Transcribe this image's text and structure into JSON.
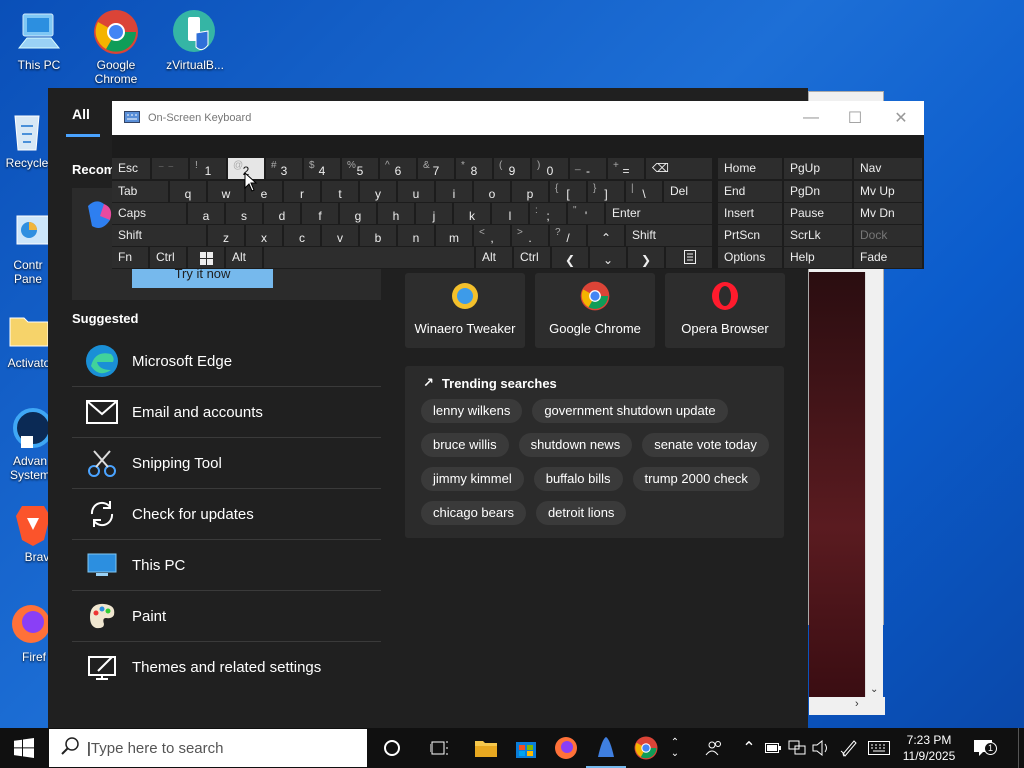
{
  "desktop": {
    "icons": [
      {
        "label": "This PC"
      },
      {
        "label": "Google Chrome"
      },
      {
        "label": "zVirtualB..."
      },
      {
        "label": "Recycle"
      },
      {
        "label": "Contr Pane"
      },
      {
        "label": "Activato"
      },
      {
        "label": "Advan System"
      },
      {
        "label": "Brav"
      },
      {
        "label": "Firef"
      }
    ]
  },
  "start_menu": {
    "tab": "All",
    "recommended_label": "Recom",
    "try_button": "Try it now",
    "suggested_label": "Suggested",
    "suggested": [
      {
        "label": "Microsoft Edge",
        "icon": "edge-icon"
      },
      {
        "label": "Email and accounts",
        "icon": "mail-icon"
      },
      {
        "label": "Snipping Tool",
        "icon": "snipping-tool-icon"
      },
      {
        "label": "Check for updates",
        "icon": "sync-icon"
      },
      {
        "label": "This PC",
        "icon": "monitor-icon"
      },
      {
        "label": "Paint",
        "icon": "palette-icon"
      },
      {
        "label": "Themes and related settings",
        "icon": "pen-screen-icon"
      }
    ],
    "quick_apps": [
      {
        "label": "Winaero Tweaker"
      },
      {
        "label": "Google Chrome"
      },
      {
        "label": "Opera Browser"
      }
    ],
    "trending_title": "Trending searches",
    "trending": [
      "lenny wilkens",
      "government shutdown update",
      "bruce willis",
      "shutdown news",
      "senate vote today",
      "jimmy kimmel",
      "buffalo bills",
      "trump 2000 check",
      "chicago bears",
      "detroit lions"
    ]
  },
  "osk": {
    "title": "On-Screen Keyboard",
    "row1": {
      "esc": "Esc",
      "k1s": "!",
      "k1": "1",
      "k2s": "@",
      "k2": "2",
      "k3s": "#",
      "k3": "3",
      "k4s": "$",
      "k4": "4",
      "k5s": "%",
      "k5": "5",
      "k6s": "^",
      "k6": "6",
      "k7s": "&",
      "k7": "7",
      "k8s": "*",
      "k8": "8",
      "k9s": "(",
      "k9": "9",
      "k0s": ")",
      "k0": "0",
      "kmin_s": "_",
      "kmin": "-",
      "keq_s": "+",
      "keq": "=",
      "home": "Home",
      "pgup": "PgUp",
      "nav": "Nav"
    },
    "row2": {
      "tab": "Tab",
      "q": "q",
      "w": "w",
      "e": "e",
      "r": "r",
      "t": "t",
      "y": "y",
      "u": "u",
      "i": "i",
      "o": "o",
      "p": "p",
      "lbs": "{",
      "lb": "[",
      "rbs": "}",
      "rb": "]",
      "bss": "|",
      "bs": "\\",
      "del": "Del",
      "end": "End",
      "pgdn": "PgDn",
      "mvup": "Mv Up"
    },
    "row3": {
      "caps": "Caps",
      "a": "a",
      "s": "s",
      "d": "d",
      "f": "f",
      "g": "g",
      "h": "h",
      "j": "j",
      "k": "k",
      "l": "l",
      "scs": ":",
      "sc": ";",
      "qts": "\"",
      "qt": "'",
      "enter": "Enter",
      "insert": "Insert",
      "pause": "Pause",
      "mvdn": "Mv Dn"
    },
    "row4": {
      "shift": "Shift",
      "z": "z",
      "x": "x",
      "c": "c",
      "v": "v",
      "b": "b",
      "n": "n",
      "m": "m",
      "cms": "<",
      "cm": ",",
      "pds": ">",
      "pd": ".",
      "sls": "?",
      "sl": "/",
      "up": "⌃",
      "shift2": "Shift",
      "prtscn": "PrtScn",
      "scrlk": "ScrLk",
      "dock": "Dock"
    },
    "row5": {
      "fn": "Fn",
      "ctrl": "Ctrl",
      "alt": "Alt",
      "alt2": "Alt",
      "ctrl2": "Ctrl",
      "left": "❮",
      "down": "⌄",
      "right": "❯",
      "options": "Options",
      "help": "Help",
      "fade": "Fade"
    }
  },
  "taskbar": {
    "search_placeholder": "Type here to search",
    "time": "7:23 PM",
    "date": "11/9/2025",
    "notification_count": "1"
  }
}
